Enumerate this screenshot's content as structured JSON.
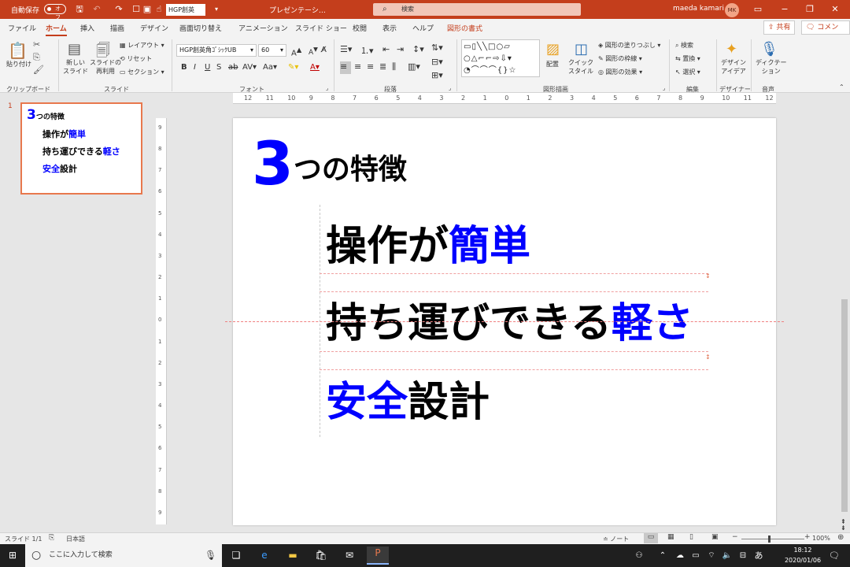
{
  "titlebar": {
    "autosave_label": "自動保存",
    "autosave_state": "オフ",
    "font_field": "HGP創英",
    "doc_title": "プレゼンテーシ…",
    "search_placeholder": "検索",
    "user_name": "maeda kamari",
    "user_initials": "MK"
  },
  "tabs": [
    "ファイル",
    "ホーム",
    "挿入",
    "描画",
    "デザイン",
    "画面切り替え",
    "アニメーション",
    "スライド ショー",
    "校閲",
    "表示",
    "ヘルプ",
    "図形の書式"
  ],
  "share_label": "共有",
  "comment_label": "コメント",
  "ribbon": {
    "clipboard": {
      "paste": "貼り付け",
      "group": "クリップボード"
    },
    "slides": {
      "new_slide": "新しい\nスライド",
      "reuse": "スライドの\n再利用",
      "layout": "レイアウト",
      "reset": "リセット",
      "section": "セクション",
      "group": "スライド"
    },
    "font": {
      "font_name": "HGP創英角ｺﾞｼｯｸUB",
      "font_size": "60",
      "group": "フォント"
    },
    "paragraph": {
      "group": "段落"
    },
    "drawing": {
      "arrange": "配置",
      "quick_style": "クイック\nスタイル",
      "fill": "図形の塗りつぶし",
      "outline": "図形の枠線",
      "effects": "図形の効果",
      "group": "図形描画"
    },
    "editing": {
      "find": "検索",
      "replace": "置換",
      "select": "選択",
      "group": "編集"
    },
    "designer": {
      "label": "デザイン\nアイデア",
      "group": "デザイナー"
    },
    "voice": {
      "label": "ディクテー\nション",
      "group": "音声"
    }
  },
  "thumbnail": {
    "number": "1",
    "lines": [
      {
        "plain": "つの特徴",
        "accent": "3",
        "accent_first": true
      },
      {
        "plain": "操作が",
        "accent": "簡単",
        "accent_first": false
      },
      {
        "plain": "持ち運びできる",
        "accent": "軽さ",
        "accent_first": false
      },
      {
        "plain": "設計",
        "accent": "安全",
        "accent_first": true
      }
    ]
  },
  "slide": {
    "title_number": "3",
    "title_rest": "つの特徴",
    "items": [
      {
        "plain": "操作が",
        "accent": "簡単"
      },
      {
        "plain": "持ち運びできる",
        "accent": "軽さ"
      },
      {
        "accent": "安全",
        "plain": "設計"
      }
    ]
  },
  "hruler_labels": [
    "12",
    "11",
    "10",
    "9",
    "8",
    "7",
    "6",
    "5",
    "4",
    "3",
    "2",
    "1",
    "0",
    "1",
    "2",
    "3",
    "4",
    "5",
    "6",
    "7",
    "8",
    "9",
    "10",
    "11",
    "12"
  ],
  "vruler_labels": [
    "9",
    "8",
    "7",
    "6",
    "5",
    "4",
    "3",
    "2",
    "1",
    "0",
    "1",
    "2",
    "3",
    "4",
    "5",
    "6",
    "7",
    "8",
    "9"
  ],
  "status": {
    "slide_count": "スライド 1/1",
    "language": "日本語",
    "notes": "ノート",
    "zoom": "100%"
  },
  "taskbar": {
    "search_placeholder": "ここに入力して検索",
    "time": "18:12",
    "date": "2020/01/06",
    "ime": "あ"
  },
  "colors": {
    "accent": "#c43e1c",
    "highlight_text": "#0000ff",
    "thumb_border": "#e8784d"
  }
}
